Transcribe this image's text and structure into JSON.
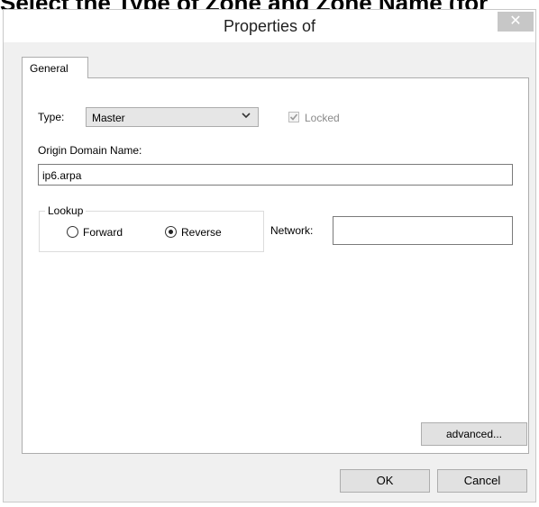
{
  "background": {
    "heading": "Select the Type of Zone and Zone Name (for"
  },
  "window": {
    "title": "Properties of",
    "close_glyph": "✕",
    "tab_general": "General",
    "type_label": "Type:",
    "type_value": "Master",
    "locked_label": "Locked",
    "locked_checked": true,
    "origin_label": "Origin Domain Name:",
    "origin_value": "ip6.arpa",
    "lookup_title": "Lookup",
    "forward_label": "Forward",
    "reverse_label": "Reverse",
    "lookup_selected": "Reverse",
    "network_label": "Network:",
    "network_value": "",
    "advanced_label": "advanced...",
    "ok_label": "OK",
    "cancel_label": "Cancel"
  },
  "colors": {
    "window_bg": "#f0f0f0",
    "panel_bg": "#ffffff",
    "close_button": "#c7c7c7"
  },
  "icons": {
    "dropdown": "chevron-down-icon",
    "check": "checkmark-icon",
    "close": "close-icon"
  }
}
